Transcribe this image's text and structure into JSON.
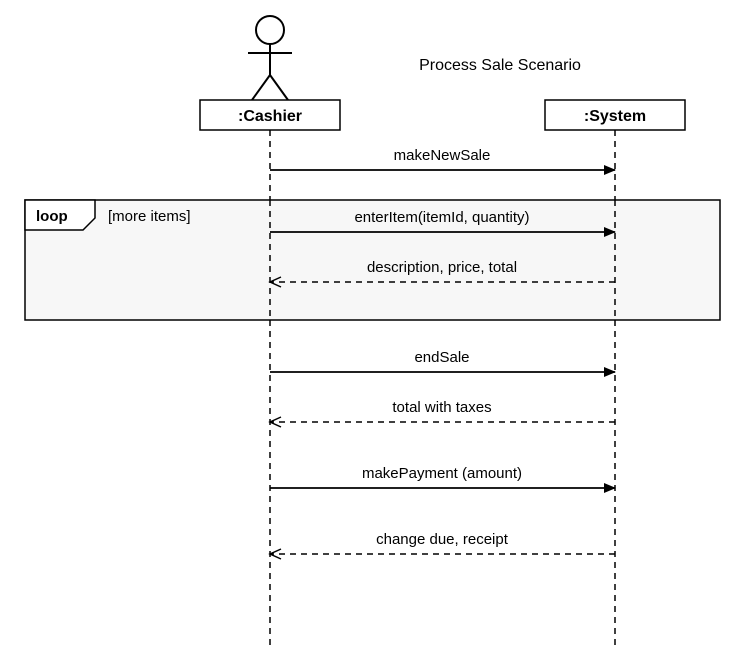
{
  "title": "Process Sale Scenario",
  "participants": {
    "cashier": ":Cashier",
    "system": ":System"
  },
  "loop": {
    "keyword": "loop",
    "guard": "[more items]"
  },
  "messages": {
    "makeNewSale": "makeNewSale",
    "enterItem": "enterItem(itemId, quantity)",
    "descPriceTotal": "description, price, total",
    "endSale": "endSale",
    "totalTaxes": "total with taxes",
    "makePayment": "makePayment (amount)",
    "changeReceipt": "change due, receipt"
  }
}
